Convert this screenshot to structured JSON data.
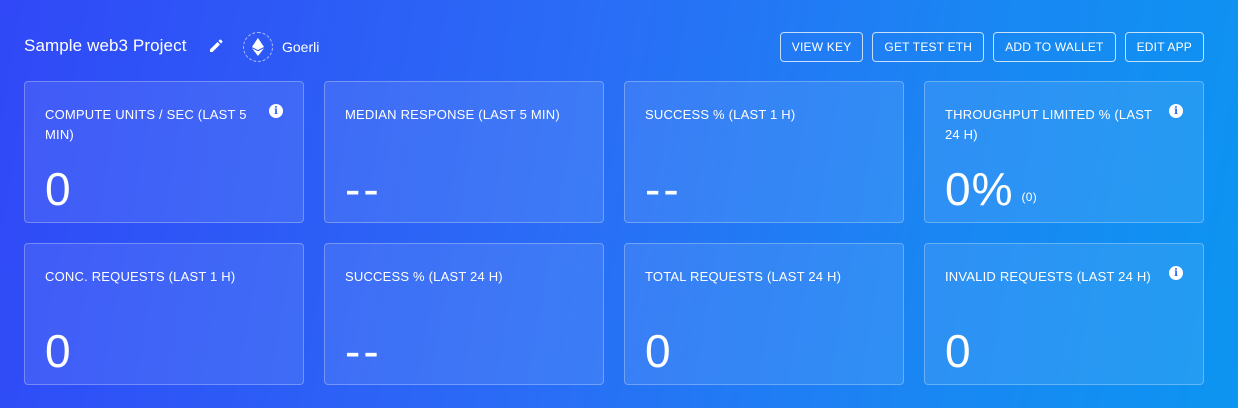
{
  "project": {
    "title": "Sample web3 Project",
    "network": "Goerli",
    "network_icon": "ethereum-icon"
  },
  "actions": [
    "VIEW KEY",
    "GET TEST ETH",
    "ADD TO WALLET",
    "EDIT APP"
  ],
  "cards": [
    {
      "label": "COMPUTE UNITS / SEC (LAST 5 MIN)",
      "value": "0",
      "info": true
    },
    {
      "label": "MEDIAN RESPONSE (LAST 5 MIN)",
      "value": "--",
      "info": false
    },
    {
      "label": "SUCCESS % (LAST 1 H)",
      "value": "--",
      "info": false
    },
    {
      "label": "THROUGHPUT LIMITED % (LAST 24 H)",
      "value": "0%",
      "sub": "(0)",
      "info": true
    },
    {
      "label": "CONC. REQUESTS (LAST 1 H)",
      "value": "0",
      "info": false
    },
    {
      "label": "SUCCESS % (LAST 24 H)",
      "value": "--",
      "info": false
    },
    {
      "label": "TOTAL REQUESTS (LAST 24 H)",
      "value": "0",
      "info": false
    },
    {
      "label": "INVALID REQUESTS (LAST 24 H)",
      "value": "0",
      "info": true
    }
  ],
  "colors": {
    "gradient_start": "#3048f7",
    "gradient_end": "#0c95f1",
    "text": "#ffffff"
  }
}
